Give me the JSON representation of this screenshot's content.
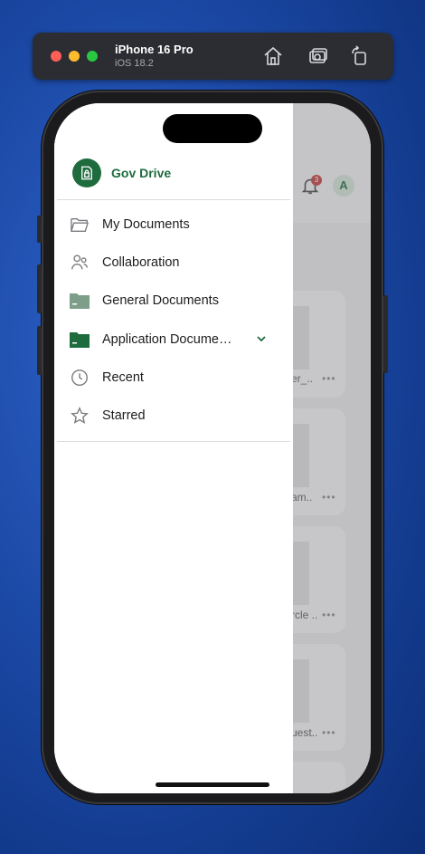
{
  "simulator": {
    "device": "iPhone 16 Pro",
    "os": "iOS 18.2",
    "icons": [
      "home-icon",
      "screenshot-icon",
      "rotate-icon"
    ]
  },
  "app": {
    "brand": "Gov Drive",
    "accent_color": "#1e6b3e",
    "drawer_items": [
      {
        "label": "My Documents",
        "icon": "folder-outline-icon"
      },
      {
        "label": "Collaboration",
        "icon": "people-icon"
      },
      {
        "label": "General Documents",
        "icon": "folder-filled-icon"
      },
      {
        "label": "Application Docume…",
        "icon": "folder-filled-icon",
        "expandable": true
      },
      {
        "label": "Recent",
        "icon": "clock-icon"
      },
      {
        "label": "Starred",
        "icon": "star-icon"
      }
    ],
    "background": {
      "notification_count": "3",
      "avatar_initial": "A",
      "file_labels": [
        "er_..",
        "am..",
        "rcle ..",
        "uest.."
      ]
    }
  }
}
